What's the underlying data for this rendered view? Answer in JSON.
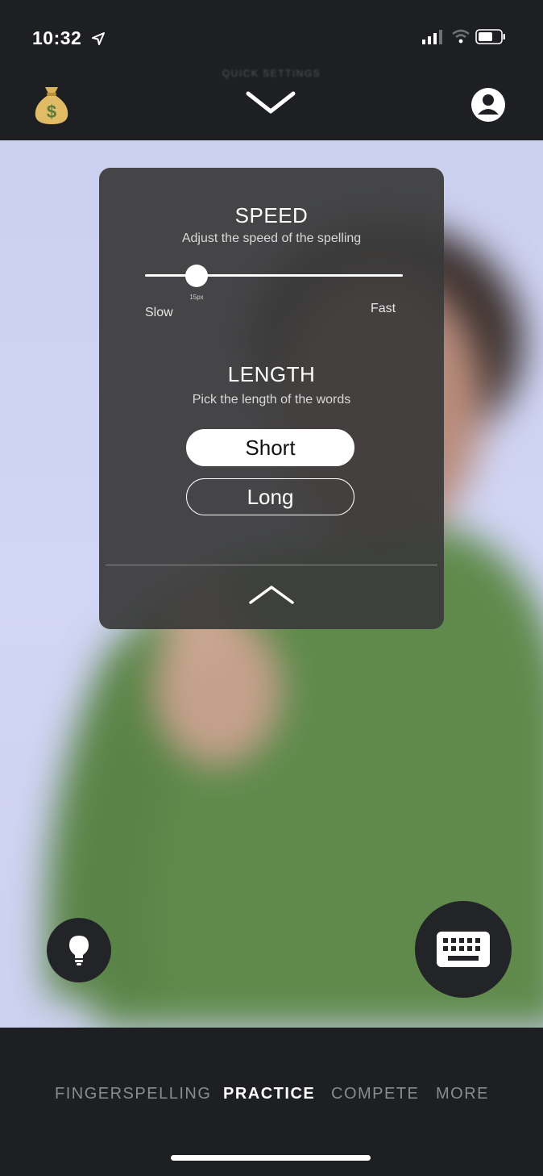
{
  "status_bar": {
    "time": "10:32"
  },
  "top_bar": {
    "quick_settings_label": "QUICK SETTINGS"
  },
  "panel": {
    "speed": {
      "title": "SPEED",
      "subtitle": "Adjust the speed of the spelling",
      "value_label": "15px",
      "slider_fraction": 0.2,
      "min_label": "Slow",
      "max_label": "Fast"
    },
    "length": {
      "title": "LENGTH",
      "subtitle": "Pick the length of the words",
      "options": [
        "Short",
        "Long"
      ],
      "selected": "Short"
    }
  },
  "bottom_nav": {
    "items": [
      "FINGERSPELLING",
      "PRACTICE",
      "COMPETE",
      "MORE"
    ],
    "active": "PRACTICE"
  },
  "colors": {
    "background": "#1e1f22",
    "panel": "#3a3a3a",
    "video_background": "#ccd0ef",
    "sweater": "#5f8a4c",
    "money_bag": "#d9b35c"
  },
  "icons": [
    "location-arrow-icon",
    "signal-icon",
    "wifi-icon",
    "battery-icon",
    "money-bag-icon",
    "chevron-down-icon",
    "profile-icon",
    "chevron-up-icon",
    "lightbulb-icon",
    "keyboard-icon"
  ]
}
